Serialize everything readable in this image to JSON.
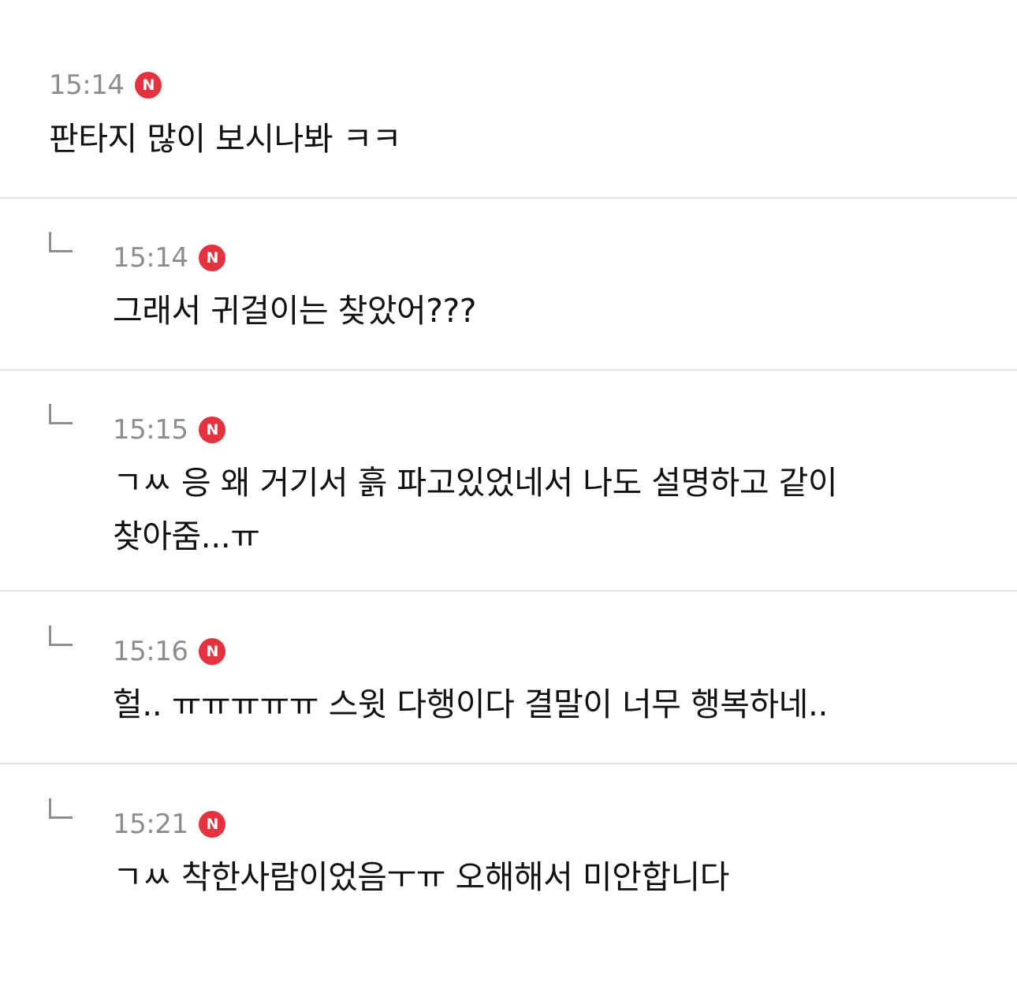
{
  "comments": [
    {
      "time": "15:14",
      "badge": "N",
      "text": "판타지 많이 보시나봐 ㅋㅋ",
      "is_reply": false
    },
    {
      "time": "15:14",
      "badge": "N",
      "text": "그래서 귀걸이는 찾았어???",
      "is_reply": true
    },
    {
      "time": "15:15",
      "badge": "N",
      "text": "ㄱㅆ 응 왜 거기서 흙 파고있었네서 나도 설명하고 같이\n찾아줌...ㅠ",
      "is_reply": true
    },
    {
      "time": "15:16",
      "badge": "N",
      "text": "헐.. ㅠㅠㅠㅠㅠ 스윗 다행이다 결말이 너무 행복하네..",
      "is_reply": true
    },
    {
      "time": "15:21",
      "badge": "N",
      "text": "ㄱㅆ 착한사람이었음ㅜㅠ 오해해서 미안합니다",
      "is_reply": true
    }
  ],
  "colors": {
    "badge": "#e5323f",
    "time": "#8d8d8d",
    "text": "#111111",
    "divider": "#e4e4e4"
  },
  "icons": {
    "badge": "new-badge-icon",
    "reply": "reply-arrow-icon"
  }
}
